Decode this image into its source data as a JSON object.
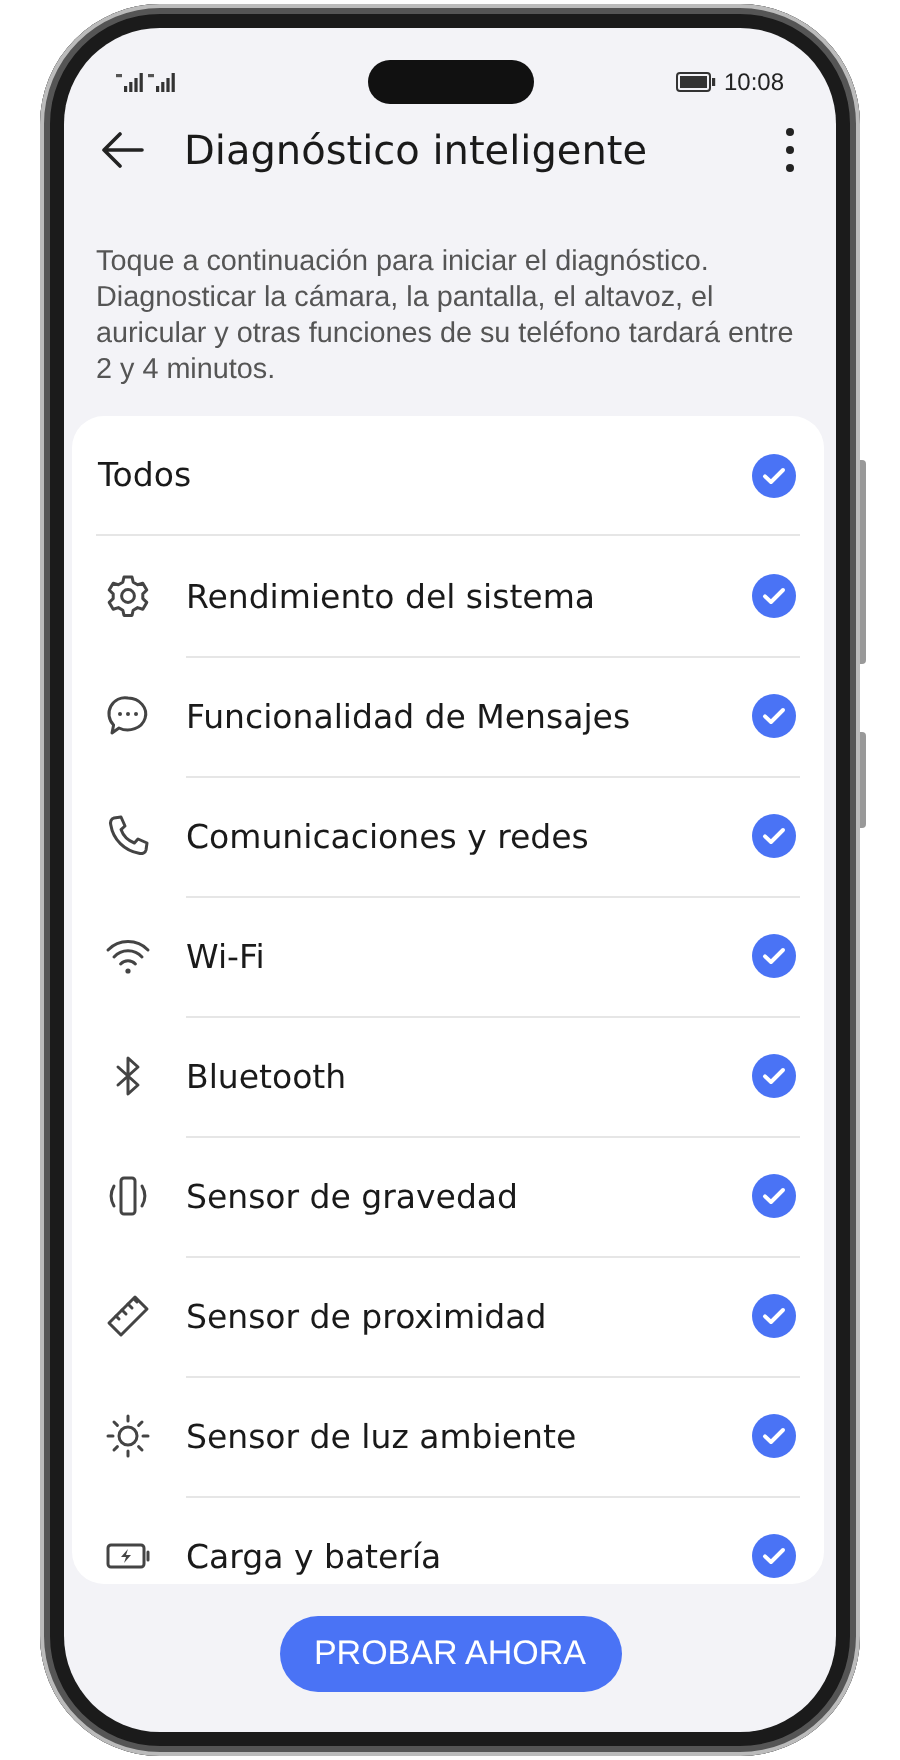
{
  "status_bar": {
    "time": "10:08"
  },
  "header": {
    "title": "Diagnóstico inteligente"
  },
  "description": "Toque a continuación para iniciar el diagnóstico. Diagnosticar la cámara, la pantalla, el altavoz, el auricular y otras funciones de su teléfono tardará entre 2 y 4 minutos.",
  "items": [
    {
      "kind": "all",
      "label": "Todos",
      "checked": true
    },
    {
      "kind": "test",
      "label": "Rendimiento del sistema",
      "checked": true
    },
    {
      "kind": "test",
      "label": "Funcionalidad de Mensajes",
      "checked": true
    },
    {
      "kind": "test",
      "label": "Comunicaciones y redes",
      "checked": true
    },
    {
      "kind": "test",
      "label": "Wi-Fi",
      "checked": true
    },
    {
      "kind": "test",
      "label": "Bluetooth",
      "checked": true
    },
    {
      "kind": "test",
      "label": "Sensor de gravedad",
      "checked": true
    },
    {
      "kind": "test",
      "label": "Sensor de proximidad",
      "checked": true
    },
    {
      "kind": "test",
      "label": "Sensor de luz ambiente",
      "checked": true
    },
    {
      "kind": "test",
      "label": "Carga y batería",
      "checked": true
    }
  ],
  "action_button": "PROBAR AHORA"
}
